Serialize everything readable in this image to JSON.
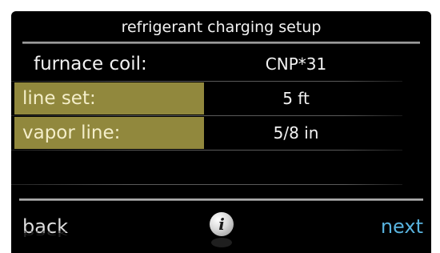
{
  "screen": {
    "title": "refrigerant charging setup"
  },
  "rows": [
    {
      "label": "furnace coil:",
      "value": "CNP*31",
      "selected": false
    },
    {
      "label": "line set:",
      "value": "5  ft",
      "selected": true
    },
    {
      "label": "vapor line:",
      "value": "5/8 in",
      "selected": true
    }
  ],
  "footer": {
    "back_label": "back",
    "info_glyph": "i",
    "next_label": "next"
  },
  "colors": {
    "background": "#000000",
    "selection_highlight": "#91883d",
    "next_accent": "#58b2dd",
    "text": "#f2f2f2"
  },
  "icons": {
    "info": "info-icon"
  }
}
